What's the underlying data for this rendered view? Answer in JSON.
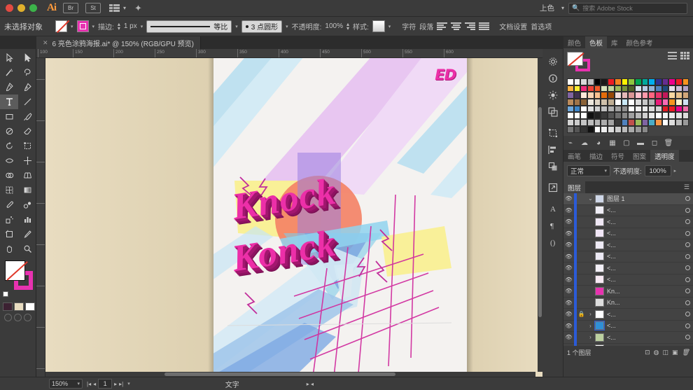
{
  "app": {
    "name": "Adobe Illustrator",
    "logo_text": "Ai",
    "menu_buttons": [
      "Br",
      "St"
    ],
    "stock_label": "上色",
    "search_placeholder": "搜索 Adobe Stock"
  },
  "control_bar": {
    "selection_status": "未选择对象",
    "fill_label": "fill-none",
    "stroke_color_label": "stroke-magenta",
    "stroke_label": "描边:",
    "stroke_width": "1 px",
    "stroke_profile": "等比",
    "brush_profile": "3 点圆形",
    "opacity_label": "不透明度:",
    "opacity_value": "100%",
    "style_label": "样式:",
    "character_label": "字符",
    "paragraph_label": "段落",
    "document_setup": "文档设置",
    "preferences": "首选项"
  },
  "document_tab": {
    "close": "✕",
    "title": "6 亮色涂鸦海报.ai* @ 150% (RGB/GPU 预览)"
  },
  "toolbar": {
    "tools": [
      {
        "name": "selection-tool",
        "glyph": "select"
      },
      {
        "name": "direct-selection-tool",
        "glyph": "direct"
      },
      {
        "name": "magic-wand-tool",
        "glyph": "wand"
      },
      {
        "name": "lasso-tool",
        "glyph": "lasso"
      },
      {
        "name": "pen-tool",
        "glyph": "pen"
      },
      {
        "name": "curvature-tool",
        "glyph": "curve"
      },
      {
        "name": "type-tool",
        "glyph": "type",
        "active": true
      },
      {
        "name": "line-segment-tool",
        "glyph": "line"
      },
      {
        "name": "rectangle-tool",
        "glyph": "rect"
      },
      {
        "name": "paintbrush-tool",
        "glyph": "brush"
      },
      {
        "name": "shaper-tool",
        "glyph": "shaper"
      },
      {
        "name": "eraser-tool",
        "glyph": "eraser"
      },
      {
        "name": "rotate-tool",
        "glyph": "rotate"
      },
      {
        "name": "scale-tool",
        "glyph": "scale"
      },
      {
        "name": "width-tool",
        "glyph": "width"
      },
      {
        "name": "free-transform-tool",
        "glyph": "transform"
      },
      {
        "name": "shape-builder-tool",
        "glyph": "shapebuild"
      },
      {
        "name": "perspective-grid-tool",
        "glyph": "perspective"
      },
      {
        "name": "mesh-tool",
        "glyph": "mesh"
      },
      {
        "name": "gradient-tool",
        "glyph": "gradient"
      },
      {
        "name": "eyedropper-tool",
        "glyph": "eyedropper"
      },
      {
        "name": "blend-tool",
        "glyph": "blend"
      },
      {
        "name": "symbol-sprayer-tool",
        "glyph": "symbol"
      },
      {
        "name": "column-graph-tool",
        "glyph": "graph"
      },
      {
        "name": "artboard-tool",
        "glyph": "artboard"
      },
      {
        "name": "slice-tool",
        "glyph": "slice"
      },
      {
        "name": "hand-tool",
        "glyph": "hand"
      },
      {
        "name": "zoom-tool",
        "glyph": "zoom"
      }
    ]
  },
  "canvas": {
    "zoom": "150%",
    "ruler_ticks_h": [
      "100",
      "150",
      "200",
      "250",
      "300",
      "350",
      "400",
      "450",
      "500",
      "550",
      "600"
    ],
    "artwork": {
      "headline_line1": "Knock",
      "headline_line2": "Konck",
      "badge": "ED",
      "colors": {
        "magenta": "#ec2fa8",
        "magenta_shadow": "#a3176f",
        "cyan": "#a9dcf0",
        "lavender": "#e3b6ee",
        "yellow": "#f7ef8f",
        "blue": "#8aa9e8",
        "orange": "#f58b74",
        "purple": "#8e7de0",
        "paper": "#f4f2f0",
        "background": "#e4d9bd"
      }
    }
  },
  "right_rail": {
    "icons": [
      "gear-icon",
      "info-icon",
      "sun-icon",
      "artboards-icon",
      "transform-icon",
      "align-icon",
      "pathfinder-icon",
      "export-icon",
      "character-icon",
      "paragraph-icon",
      "glyphs-icon"
    ]
  },
  "color_panel": {
    "tabs": [
      "颜色",
      "色板",
      "库",
      "颜色参考"
    ],
    "active_tab": "色板",
    "swatch_rows": [
      [
        "#ffffff",
        "#f2f2f2",
        "#d9d9d9",
        "#bfbfbf",
        "#000000",
        "#1a1a1a",
        "#ed1c24",
        "#f5821f",
        "#fff200",
        "#8dc63f",
        "#00a651",
        "#00a99d",
        "#00aeef",
        "#2e3192",
        "#662d91",
        "#ec008c",
        "#ed1c24",
        "#f7941e",
        "#fbb040",
        "#f9ed32",
        "#ee2a7b",
        "#ef4136",
        "#f15a29"
      ],
      [
        "#d7e3bc",
        "#c3d69b",
        "#9bbb59",
        "#77933c",
        "#4f6228",
        "#dbe5f1",
        "#b8cce4",
        "#95b3d7",
        "#4f81bd",
        "#1f497d",
        "#e5e0ec",
        "#ccc0d9",
        "#b2a2c7",
        "#8064a2",
        "#3f3151",
        "#fde9d9",
        "#fbd5b5",
        "#fac08f",
        "#e36c0a",
        "#974806",
        "#f2dcdb",
        "#e5b8b7",
        "#da9694"
      ],
      [
        "#ffc0cb",
        "#ff99aa",
        "#ff6680",
        "#e8336b",
        "#c2185b",
        "#f8d7a0",
        "#e8c08a",
        "#d2a679",
        "#bb8b5c",
        "#a07449",
        "#8a6237",
        "#ede7dd",
        "#dfd4c4",
        "#cfc0aa",
        "#bfae94",
        "#ffffff",
        "#c9e8f5",
        "#ffffff",
        "#dcdcdc",
        "#c8c8c8",
        "#b4b4b4",
        "#ea1c79",
        "#f96ab4"
      ],
      [
        "#f7941e",
        "#fff2cc",
        "#cfe2f3",
        "#6fa8dc",
        "#3d85c8",
        "#ffffff",
        "#e0e0e0",
        "#d0d0d0",
        "#c0c0c0",
        "#b0b0b0",
        "#a0a0a0",
        "#909090",
        "#ffffff",
        "#f0f0f0",
        "#e8e8e8",
        "#dcdcdc",
        "#d4d4d4",
        "#e01b24",
        "#ed1c24",
        "#ec008c",
        "#f06eaa",
        "#ffffff",
        "#ffffff"
      ],
      [
        "#ffffff",
        "#111111",
        "#222222",
        "#3a3a3a",
        "#555555",
        "#6e6e6e",
        "#888888",
        "#a0a0a0",
        "#b8b8b8",
        "#d0d0d0",
        "#e8e8e8",
        "#ffffff",
        "#f4f4f4",
        "#ececec",
        "#e4e4e4",
        "#dcdcdc",
        "#d4d4d4",
        "#cccccc",
        "#c4c4c4",
        "#bcbcbc",
        "#b4b4b4",
        "#acacac",
        "#a4a4a4"
      ],
      [
        "#3a3a3a",
        "#4f81bd",
        "#c0504d",
        "#9bbb59",
        "#8064a2",
        "#4bacc6",
        "#f79646",
        "#ffffff",
        "#dddddd",
        "#bbbbbb",
        "#999999",
        "#777777",
        "#555555",
        "#333333",
        "#111111",
        "#ffffff",
        "#eeeeee",
        "#dddddd",
        "#cccccc",
        "#bbbbbb",
        "#aaaaaa",
        "#999999",
        "#888888"
      ]
    ]
  },
  "transparency_panel": {
    "tabs": [
      "画笔",
      "描边",
      "符号",
      "图案",
      "透明度"
    ],
    "active_tab": "透明度",
    "blend_mode": "正常",
    "opacity_label": "不透明度:",
    "opacity_value": "100%"
  },
  "layers_panel": {
    "title": "图层",
    "root_layer": "图层 1",
    "rows": [
      {
        "name": "<路径>",
        "short": "<...",
        "thumb": "#f0eef6",
        "locked": false,
        "expand": false,
        "selected": false
      },
      {
        "name": "<路径>",
        "short": "<...",
        "thumb": "#efe7f4",
        "locked": false,
        "expand": false,
        "selected": false
      },
      {
        "name": "<路径>",
        "short": "<...",
        "thumb": "#f1e6f6",
        "locked": false,
        "expand": false,
        "selected": false
      },
      {
        "name": "<路径>",
        "short": "<...",
        "thumb": "#eeeaf5",
        "locked": false,
        "expand": false,
        "selected": false
      },
      {
        "name": "<路径>",
        "short": "<...",
        "thumb": "#ece9f4",
        "locked": false,
        "expand": false,
        "selected": false
      },
      {
        "name": "<路径>",
        "short": "<...",
        "thumb": "#f3f0f7",
        "locked": false,
        "expand": false,
        "selected": false
      },
      {
        "name": "<路径>",
        "short": "<...",
        "thumb": "#f7e9f3",
        "locked": false,
        "expand": false,
        "selected": false
      },
      {
        "name": "Knock",
        "short": "Kn...",
        "thumb": "#e832b0",
        "locked": false,
        "expand": false,
        "selected": false
      },
      {
        "name": "Konck",
        "short": "Kn...",
        "thumb": "#dddddd",
        "locked": false,
        "expand": false,
        "selected": false
      },
      {
        "name": "<编组>",
        "short": "<...",
        "thumb": "#ffffff",
        "locked": true,
        "expand": true,
        "selected": false
      },
      {
        "name": "<编组>",
        "short": "<...",
        "thumb": "#2f8fd8",
        "locked": false,
        "expand": true,
        "selected": true
      },
      {
        "name": "<编组>",
        "short": "<...",
        "thumb": "#bcd0a0",
        "locked": false,
        "expand": true,
        "selected": false
      },
      {
        "name": "<编组>",
        "short": "<...",
        "thumb": "#ffffff",
        "locked": false,
        "expand": true,
        "selected": false
      },
      {
        "name": "<编组>",
        "short": "<...",
        "thumb": "#eeeeee",
        "locked": false,
        "expand": true,
        "selected": false
      }
    ],
    "footer_count": "1 个图层"
  },
  "status_bar": {
    "zoom": "150%",
    "page_number": "1",
    "current_tool": "文字"
  }
}
